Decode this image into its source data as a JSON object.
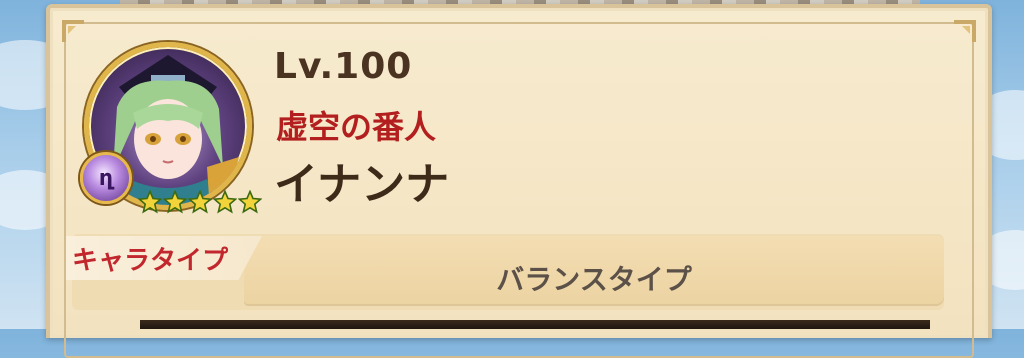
{
  "character": {
    "level_text": "Lv.100",
    "title": "虚空の番人",
    "name": "イナンナ",
    "rarity_stars": 5,
    "element_icon": "void-element-icon"
  },
  "type_section": {
    "label": "キャラタイプ",
    "value": "バランスタイプ"
  },
  "colors": {
    "panel_bg": "#f5e6c6",
    "title_red": "#b31f1f",
    "name_brown": "#3e2a18",
    "star_yellow": "#f2d33a",
    "frame_gold": "#e0b64a"
  }
}
